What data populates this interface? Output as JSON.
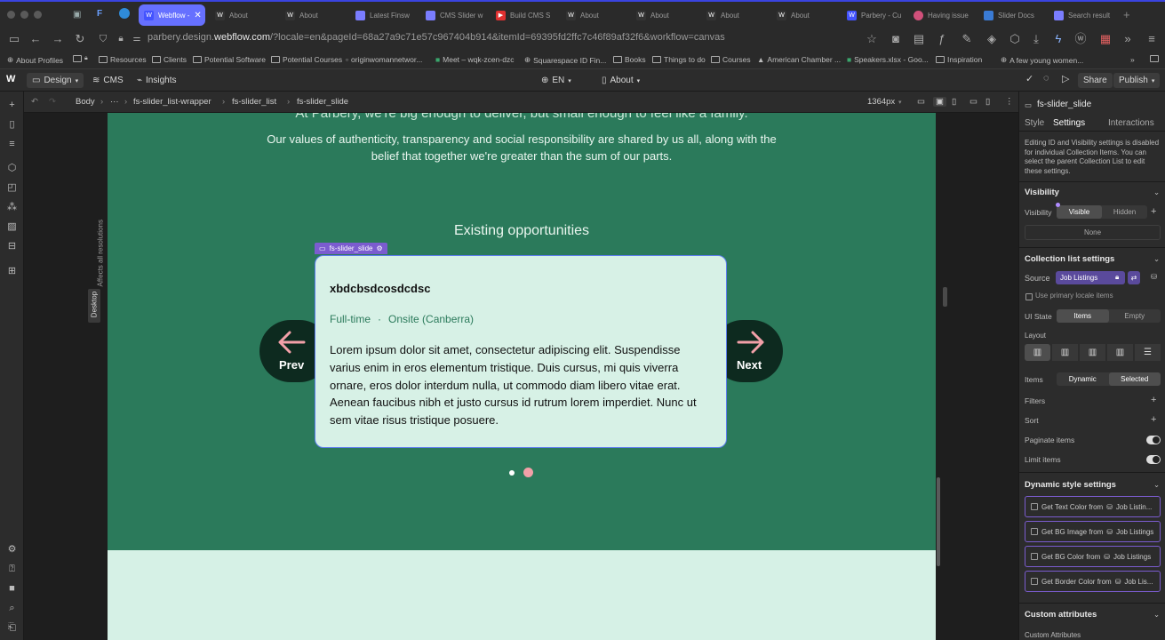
{
  "browser": {
    "tabs": [
      {
        "label": "Webflow -",
        "active": true,
        "icon": "webflow-icon"
      },
      {
        "label": "About",
        "icon": "webflow-icon"
      },
      {
        "label": "About",
        "icon": "webflow-icon"
      },
      {
        "label": "Latest Finsw",
        "icon": "finsweet-icon"
      },
      {
        "label": "CMS Slider w",
        "icon": "finsweet-icon"
      },
      {
        "label": "Build CMS S",
        "icon": "youtube-icon"
      },
      {
        "label": "About",
        "icon": "webflow-icon"
      },
      {
        "label": "About",
        "icon": "webflow-icon"
      },
      {
        "label": "About",
        "icon": "webflow-icon"
      },
      {
        "label": "About",
        "icon": "webflow-icon"
      },
      {
        "label": "Parbery - Cu",
        "icon": "webflow-icon"
      },
      {
        "label": "Having issue",
        "icon": "forum-icon"
      },
      {
        "label": "Slider Docs",
        "icon": "finsweet-icon"
      },
      {
        "label": "Search result",
        "icon": "finsweet-icon"
      }
    ],
    "url_prefix": "parbery.design.",
    "url_host": "webflow.com",
    "url_rest": "/?locale=en&pageId=68a27a9c71e57c967404b914&itemId=69395fd2ffc7c46f89af32f6&workflow=canvas",
    "bookmarks": [
      "About Profiles",
      "Resources",
      "Clients",
      "Potential Software",
      "Potential Courses",
      "originwomannetwor...",
      "Meet – wqk-zcen-dzc",
      "Squarespace ID Fin...",
      "Books",
      "Things to do",
      "Courses",
      "American Chamber ...",
      "Speakers.xlsx - Goo...",
      "Inspiration",
      "A few young women..."
    ]
  },
  "wf": {
    "design_label": "Design",
    "cms_label": "CMS",
    "insights_label": "Insights",
    "locale": "EN",
    "page": "About",
    "share_label": "Share",
    "publish_label": "Publish",
    "breadcrumb": [
      "Body",
      "···",
      "fs-slider_list-wrapper",
      "fs-slider_list",
      "fs-slider_slide"
    ],
    "width_readout": "1364px",
    "side_label_affects": "Affects all resolutions",
    "side_label_desktop": "Desktop"
  },
  "site": {
    "top_line": "At Parbery, we're big enough to deliver, but small enough to feel like a family.",
    "values_text": "Our values of authenticity, transparency and social responsibility are shared by us all, along with the belief that together we're greater than the sum of our parts.",
    "section_title": "Existing opportunities",
    "slide_badge": "fs-slider_slide",
    "card": {
      "title": "xbdcbsdcosdcdsc",
      "job_type": "Full-time",
      "separator": "·",
      "location": "Onsite (Canberra)",
      "body": "Lorem ipsum dolor sit amet, consectetur adipiscing elit. Suspendisse varius enim in eros elementum tristique. Duis cursus, mi quis viverra ornare, eros dolor interdum nulla, ut commodo diam libero vitae erat. Aenean faucibus nibh et justo cursus id rutrum lorem imperdiet. Nunc ut sem vitae risus tristique posuere."
    },
    "prev_label": "Prev",
    "next_label": "Next",
    "colors": {
      "brand_green": "#2b7a5b",
      "card_bg": "#d7f1e6",
      "arrow_pink": "#f2a0a8",
      "pill_dark": "#0d2a1f"
    }
  },
  "panel": {
    "element_name": "fs-slider_slide",
    "tabs": [
      "Style",
      "Settings",
      "Interactions"
    ],
    "active_tab": "Settings",
    "notice": "Editing ID and Visibility settings is disabled for individual Collection Items. You can select the parent Collection List to edit these settings.",
    "visibility": {
      "title": "Visibility",
      "label": "Visibility",
      "visible": "Visible",
      "hidden": "Hidden",
      "none": "None"
    },
    "collection": {
      "title": "Collection list settings",
      "source_label": "Source",
      "source_value": "Job Listings",
      "primary_locale": "Use primary locale items",
      "ui_state_label": "UI State",
      "ui_items": "Items",
      "ui_empty": "Empty",
      "layout_label": "Layout",
      "items_label": "Items",
      "items_dynamic": "Dynamic",
      "items_selected": "Selected",
      "filters": "Filters",
      "sort": "Sort",
      "paginate": "Paginate items",
      "limit": "Limit items"
    },
    "dynamic": {
      "title": "Dynamic style settings",
      "rows": [
        {
          "label": "Get Text Color from",
          "source": "Job Listin..."
        },
        {
          "label": "Get BG Image from",
          "source": "Job Listings"
        },
        {
          "label": "Get BG Color from",
          "source": "Job Listings"
        },
        {
          "label": "Get Border Color from",
          "source": "Job Lis..."
        }
      ]
    },
    "custom": {
      "title": "Custom attributes",
      "label": "Custom Attributes"
    }
  }
}
